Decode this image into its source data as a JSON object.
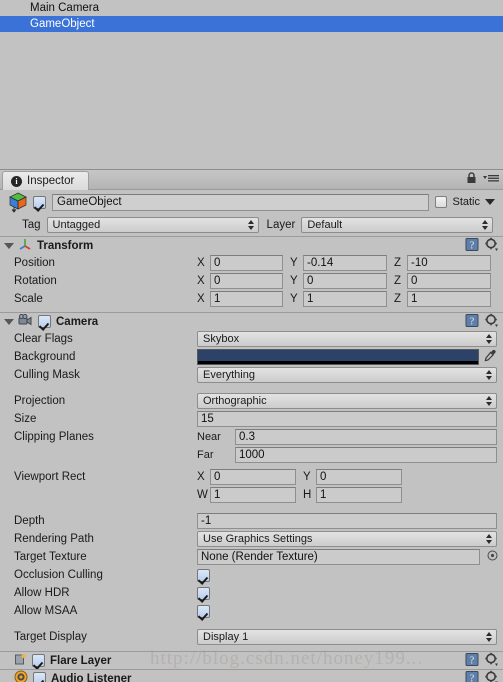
{
  "hierarchy": {
    "items": [
      {
        "label": "Main Camera",
        "selected": false
      },
      {
        "label": "GameObject",
        "selected": true
      }
    ]
  },
  "tabbar": {
    "tab_label": "Inspector",
    "info_glyph": "i",
    "lock_icon": "lock-icon",
    "menu_icon": "hamburger-menu-icon"
  },
  "object_header": {
    "icon": "gameobject-cube-icon",
    "enabled": true,
    "name": "GameObject",
    "static_label": "Static",
    "static_checked": false
  },
  "tag_layer": {
    "tag_label": "Tag",
    "tag_value": "Untagged",
    "layer_label": "Layer",
    "layer_value": "Default"
  },
  "transform": {
    "title": "Transform",
    "icon": "transform-axis-icon",
    "expanded": true,
    "rows": [
      {
        "label": "Position",
        "x": "0",
        "y": "-0.14",
        "z": "-10"
      },
      {
        "label": "Rotation",
        "x": "0",
        "y": "0",
        "z": "0"
      },
      {
        "label": "Scale",
        "x": "1",
        "y": "1",
        "z": "1"
      }
    ],
    "axes": [
      "X",
      "Y",
      "Z"
    ]
  },
  "camera": {
    "title": "Camera",
    "icon": "camera-icon",
    "enabled": true,
    "expanded": true,
    "clear_flags_label": "Clear Flags",
    "clear_flags_value": "Skybox",
    "background_label": "Background",
    "background_color": "#2c4367",
    "eyedropper_icon": "eyedropper-icon",
    "culling_mask_label": "Culling Mask",
    "culling_mask_value": "Everything",
    "projection_label": "Projection",
    "projection_value": "Orthographic",
    "size_label": "Size",
    "size_value": "15",
    "clipping_label": "Clipping Planes",
    "near_label": "Near",
    "near_value": "0.3",
    "far_label": "Far",
    "far_value": "1000",
    "viewport_label": "Viewport Rect",
    "viewport_x_label": "X",
    "viewport_x_value": "0",
    "viewport_y_label": "Y",
    "viewport_y_value": "0",
    "viewport_w_label": "W",
    "viewport_w_value": "1",
    "viewport_h_label": "H",
    "viewport_h_value": "1",
    "depth_label": "Depth",
    "depth_value": "-1",
    "rendering_path_label": "Rendering Path",
    "rendering_path_value": "Use Graphics Settings",
    "target_texture_label": "Target Texture",
    "target_texture_value": "None (Render Texture)",
    "object_picker_icon": "object-picker-icon",
    "occlusion_label": "Occlusion Culling",
    "occlusion_checked": true,
    "hdr_label": "Allow HDR",
    "hdr_checked": true,
    "msaa_label": "Allow MSAA",
    "msaa_checked": true,
    "target_display_label": "Target Display",
    "target_display_value": "Display 1"
  },
  "flare_layer": {
    "title": "Flare Layer",
    "icon": "flare-layer-icon",
    "enabled": true
  },
  "audio_listener": {
    "title": "Audio Listener",
    "icon": "audio-listener-icon",
    "enabled": true
  },
  "component_icons": {
    "help_icon": "help-book-icon",
    "settings_icon": "gear-icon"
  },
  "watermark": {
    "text": "http://blog.csdn.net/honey199..."
  }
}
